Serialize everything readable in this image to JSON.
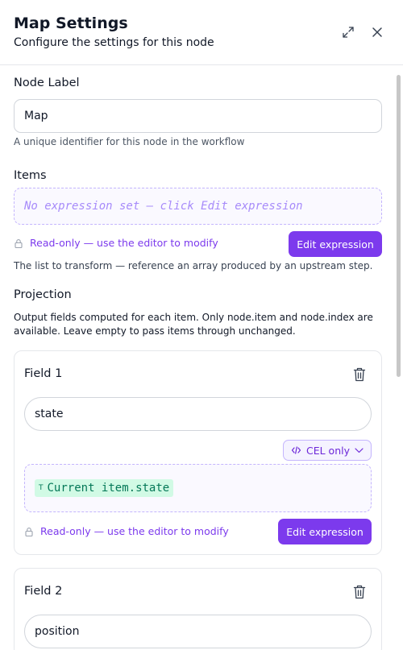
{
  "header": {
    "title": "Map Settings",
    "subtitle": "Configure the settings for this node",
    "expand_icon": "expand-icon",
    "close_icon": "close-icon"
  },
  "node_label": {
    "label": "Node Label",
    "value": "Map",
    "help": "A unique identifier for this node in the workflow"
  },
  "items": {
    "label": "Items",
    "placeholder": "No expression set — click Edit expression",
    "readonly_text": "Read-only — use the editor to modify",
    "edit_button": "Edit expression",
    "help": "The list to transform — reference an array produced by an upstream step."
  },
  "projection": {
    "label": "Projection",
    "help": "Output fields computed for each item. Only node.item and node.index are available. Leave empty to pass items through unchanged.",
    "fields": [
      {
        "title": "Field 1",
        "name": "state",
        "mode": "CEL only",
        "token_type": "T",
        "token_text": "Current item.state",
        "readonly_text": "Read-only — use the editor to modify",
        "edit_button": "Edit expression"
      },
      {
        "title": "Field 2",
        "name": "position"
      }
    ]
  },
  "colors": {
    "accent": "#7c3aed",
    "token_bg": "#d1fae5",
    "token_text": "#047857"
  }
}
